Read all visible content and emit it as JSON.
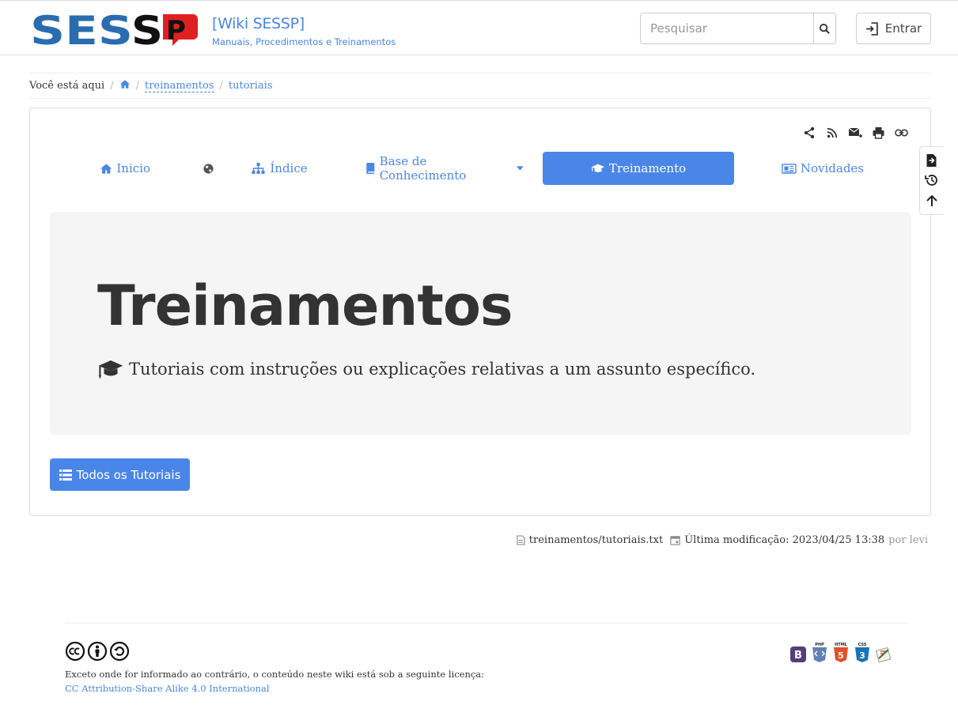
{
  "header": {
    "logo_text": "SESSP",
    "site_title": "[Wiki SESSP]",
    "tagline": "Manuais, Procedimentos e Treinamentos",
    "search_placeholder": "Pesquisar",
    "login_label": "Entrar"
  },
  "breadcrumb": {
    "label": "Você está aqui",
    "items": [
      "treinamentos",
      "tutoriais"
    ]
  },
  "page_tools": [
    "share-icon",
    "rss-icon",
    "email-icon",
    "print-icon",
    "link-icon"
  ],
  "nav": {
    "items": [
      {
        "label": "Inicio",
        "icon": "home-icon"
      },
      {
        "label": "",
        "icon": "globe-icon"
      },
      {
        "label": "Índice",
        "icon": "sitemap-icon"
      },
      {
        "label": "Base de Conhecimento",
        "icon": "book-icon"
      },
      {
        "label": "Treinamento",
        "icon": "graduation-cap-icon"
      },
      {
        "label": "Novidades",
        "icon": "newspaper-icon"
      }
    ],
    "active": "Treinamento"
  },
  "jumbotron": {
    "title": "Treinamentos",
    "subtitle": "Tutoriais com instruções ou explicações relativas a um assunto específico."
  },
  "all_tutorials_button": "Todos os Tutoriais",
  "side_tools": [
    "export-pdf-icon",
    "history-icon",
    "back-to-top-icon"
  ],
  "docinfo": {
    "file": "treinamentos/tutoriais.txt",
    "last_modified_label": "Última modificação: 2023/04/25 13:38",
    "author": "por levi"
  },
  "footer": {
    "license_text": "Exceto onde for informado ao contrário, o conteúdo neste wiki está sob a seguinte licença:",
    "license_link": "CC Attribution-Share Alike 4.0 International",
    "badges": [
      "B",
      "PHP",
      "HTML",
      "CSS"
    ]
  },
  "colors": {
    "accent": "#4a86e8",
    "jumbotron_bg": "#f5f5f5",
    "logo_blue": "#2b6cb0",
    "logo_red": "#e02020"
  }
}
